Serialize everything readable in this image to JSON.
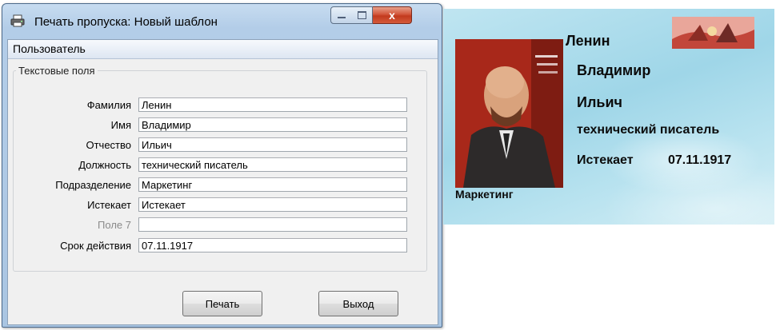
{
  "window": {
    "title": "Печать пропуска: Новый шаблон",
    "menu": "Пользователь",
    "group_label": "Текстовые поля",
    "fields": [
      {
        "label": "Фамилия",
        "value": "Ленин",
        "enabled": true
      },
      {
        "label": "Имя",
        "value": "Владимир",
        "enabled": true
      },
      {
        "label": "Отчество",
        "value": "Ильич",
        "enabled": true
      },
      {
        "label": "Должность",
        "value": "технический писатель",
        "enabled": true
      },
      {
        "label": "Подразделение",
        "value": "Маркетинг",
        "enabled": true
      },
      {
        "label": "Истекает",
        "value": "Истекает",
        "enabled": true
      },
      {
        "label": "Поле 7",
        "value": "",
        "enabled": false
      },
      {
        "label": "Срок действия",
        "value": "07.11.1917",
        "enabled": true
      }
    ],
    "buttons": {
      "print": "Печать",
      "exit": "Выход"
    },
    "close_glyph": "x"
  },
  "badge": {
    "last_name": "Ленин",
    "first_name": "Владимир",
    "patronymic": "Ильич",
    "position": "технический писатель",
    "expires_label": "Истекает",
    "expires_date": "07.11.1917",
    "department": "Маркетинг",
    "background_color": "#a8dbeb"
  },
  "colors": {
    "window_frame": "#b3cde8",
    "close_button": "#c94a2e",
    "client_bg": "#f0f0f0"
  },
  "icons": [
    "printer-icon",
    "minimize-icon",
    "maximize-icon",
    "close-icon"
  ]
}
